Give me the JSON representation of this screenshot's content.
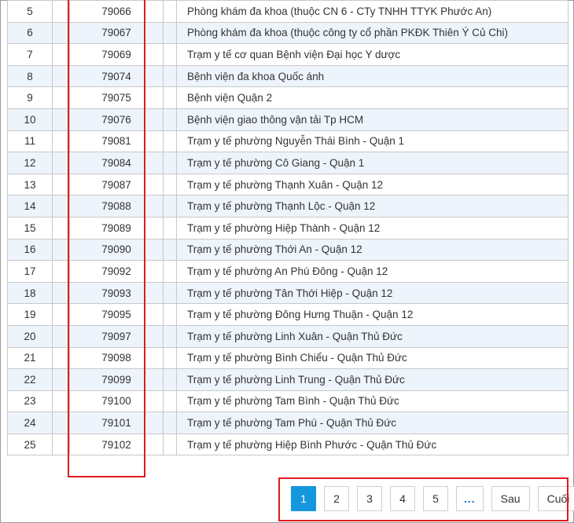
{
  "rows": [
    {
      "stt": "5",
      "code": "79066",
      "name": "Phòng khám đa khoa (thuộc CN 6 - CTy TNHH TTYK Phước An)"
    },
    {
      "stt": "6",
      "code": "79067",
      "name": "Phòng khám đa khoa (thuộc công ty cổ phần PKĐK Thiên Ý Củ Chi)"
    },
    {
      "stt": "7",
      "code": "79069",
      "name": "Trạm y tế cơ quan Bệnh viện Đại học Y dược"
    },
    {
      "stt": "8",
      "code": "79074",
      "name": "Bệnh viện đa khoa Quốc ánh"
    },
    {
      "stt": "9",
      "code": "79075",
      "name": "Bệnh viện Quận 2"
    },
    {
      "stt": "10",
      "code": "79076",
      "name": "Bệnh viện giao thông vận tải Tp HCM"
    },
    {
      "stt": "11",
      "code": "79081",
      "name": "Trạm y tế phường Nguyễn Thái Bình - Quận 1"
    },
    {
      "stt": "12",
      "code": "79084",
      "name": "Trạm y tế phường Cô Giang - Quận 1"
    },
    {
      "stt": "13",
      "code": "79087",
      "name": "Trạm y tế phường Thạnh Xuân - Quận 12"
    },
    {
      "stt": "14",
      "code": "79088",
      "name": "Trạm y tế phường Thạnh Lộc - Quận 12"
    },
    {
      "stt": "15",
      "code": "79089",
      "name": "Trạm y tế phường Hiệp Thành - Quận 12"
    },
    {
      "stt": "16",
      "code": "79090",
      "name": "Trạm y tế phường Thới An - Quận 12"
    },
    {
      "stt": "17",
      "code": "79092",
      "name": "Trạm y tế phường An Phú Đông - Quận 12"
    },
    {
      "stt": "18",
      "code": "79093",
      "name": "Trạm y tế phường Tân Thới Hiệp - Quận 12"
    },
    {
      "stt": "19",
      "code": "79095",
      "name": "Trạm y tế phường Đông Hưng Thuận - Quận 12"
    },
    {
      "stt": "20",
      "code": "79097",
      "name": "Trạm y tế phường Linh Xuân - Quận Thủ Đức"
    },
    {
      "stt": "21",
      "code": "79098",
      "name": "Trạm y tế phường Bình Chiểu - Quận Thủ Đức"
    },
    {
      "stt": "22",
      "code": "79099",
      "name": "Trạm y tế phường Linh Trung - Quận Thủ Đức"
    },
    {
      "stt": "23",
      "code": "79100",
      "name": "Trạm y tế phường Tam Bình - Quận Thủ Đức"
    },
    {
      "stt": "24",
      "code": "79101",
      "name": "Trạm y tế phường Tam Phú - Quận Thủ Đức"
    },
    {
      "stt": "25",
      "code": "79102",
      "name": "Trạm y tế phường Hiệp Bình Phước - Quận Thủ Đức"
    }
  ],
  "pagination": {
    "pages": [
      "1",
      "2",
      "3",
      "4",
      "5"
    ],
    "current": "1",
    "ellipsis": "...",
    "next_label": "Sau",
    "last_label": "Cuối"
  },
  "colors": {
    "accent": "#1597dd",
    "highlight": "#e01b1b",
    "row_alt": "#eef4fb"
  }
}
